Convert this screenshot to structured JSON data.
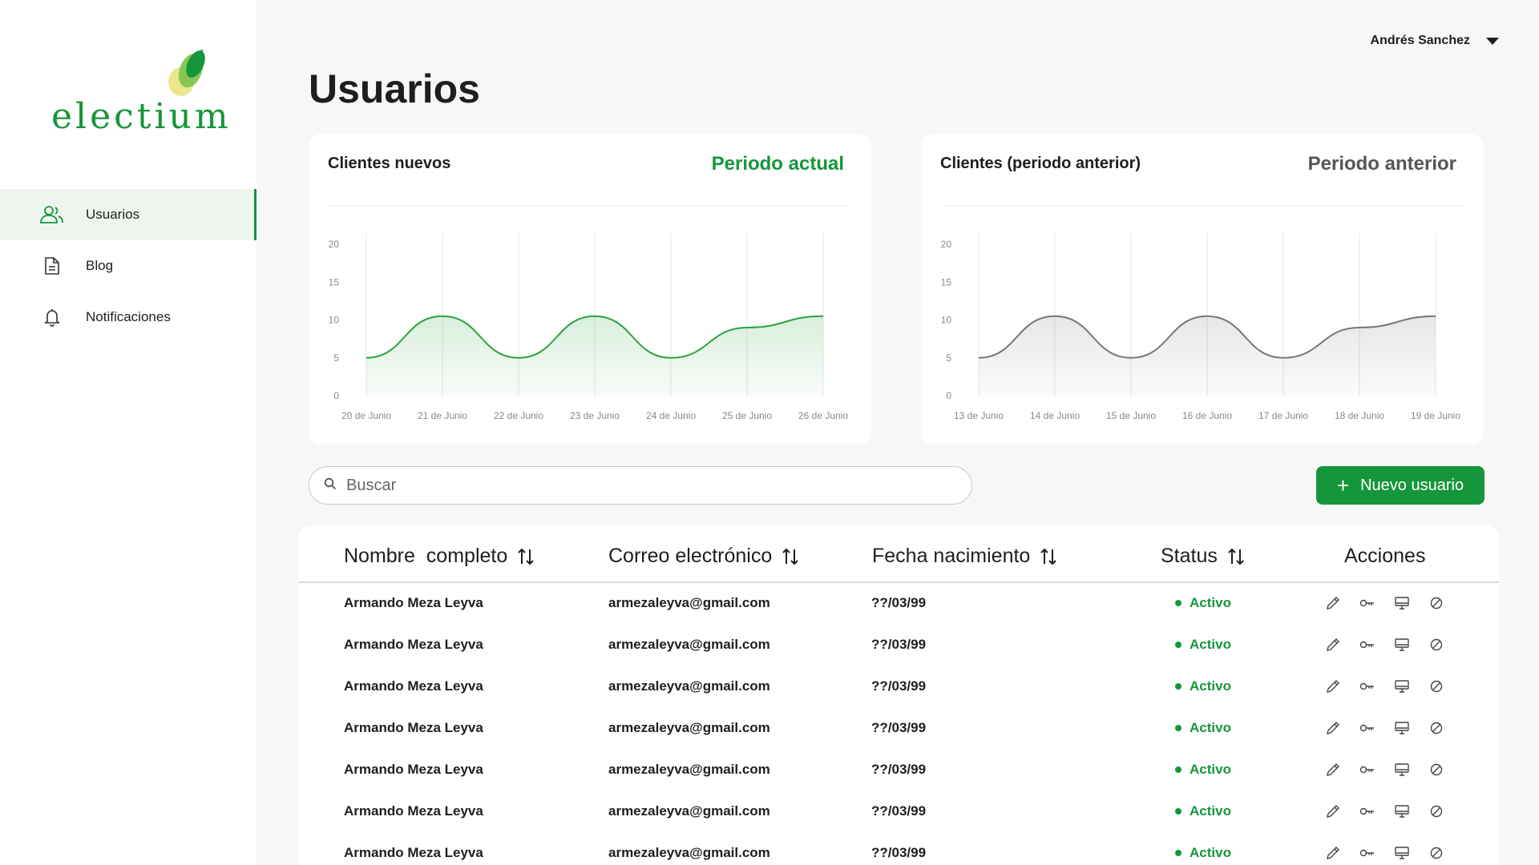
{
  "brand": {
    "name": "electium",
    "color": "#15963a"
  },
  "sidebar": {
    "items": [
      {
        "label": "Usuarios",
        "icon": "users-icon",
        "active": true
      },
      {
        "label": "Blog",
        "icon": "document-icon",
        "active": false
      },
      {
        "label": "Notificaciones",
        "icon": "bell-icon",
        "active": false
      }
    ]
  },
  "header": {
    "user_name": "Andrés Sanchez",
    "title": "Usuarios"
  },
  "cards": [
    {
      "title": "Clientes nuevos",
      "period": "Periodo actual",
      "period_color": "#15963a"
    },
    {
      "title": "Clientes (periodo anterior)",
      "period": "Periodo anterior",
      "period_color": "#555555"
    }
  ],
  "chart_data": [
    {
      "type": "area",
      "title": "Clientes nuevos",
      "categories": [
        "20 de Junio",
        "21 de Junio",
        "22 de Junio",
        "23 de Junio",
        "24 de Junio",
        "25 de Junio",
        "26 de Junio"
      ],
      "values": [
        5,
        10.5,
        5,
        10.5,
        5,
        9,
        10.5
      ],
      "ylim": [
        0,
        20
      ],
      "yticks": [
        0,
        5,
        10,
        15,
        20
      ],
      "color": "#2aa33e",
      "grid": "vertical"
    },
    {
      "type": "area",
      "title": "Clientes (periodo anterior)",
      "categories": [
        "13 de Junio",
        "14 de Junio",
        "15 de Junio",
        "16 de Junio",
        "17 de Junio",
        "18 de Junio",
        "19 de Junio"
      ],
      "values": [
        5,
        10.5,
        5,
        10.5,
        5,
        9,
        10.5
      ],
      "ylim": [
        0,
        20
      ],
      "yticks": [
        0,
        5,
        10,
        15,
        20
      ],
      "color": "#777777",
      "grid": "vertical"
    }
  ],
  "search": {
    "placeholder": "Buscar"
  },
  "new_user_button": {
    "label": "Nuevo usuario"
  },
  "table": {
    "columns": [
      "Nombre  completo",
      "Correo electrónico",
      "Fecha nacimiento",
      "Status",
      "Acciones"
    ],
    "rows": [
      {
        "name": "Armando Meza Leyva",
        "email": "armezaleyva@gmail.com",
        "birth": "??/03/99",
        "status": "Activo"
      },
      {
        "name": "Armando Meza Leyva",
        "email": "armezaleyva@gmail.com",
        "birth": "??/03/99",
        "status": "Activo"
      },
      {
        "name": "Armando Meza Leyva",
        "email": "armezaleyva@gmail.com",
        "birth": "??/03/99",
        "status": "Activo"
      },
      {
        "name": "Armando Meza Leyva",
        "email": "armezaleyva@gmail.com",
        "birth": "??/03/99",
        "status": "Activo"
      },
      {
        "name": "Armando Meza Leyva",
        "email": "armezaleyva@gmail.com",
        "birth": "??/03/99",
        "status": "Activo"
      },
      {
        "name": "Armando Meza Leyva",
        "email": "armezaleyva@gmail.com",
        "birth": "??/03/99",
        "status": "Activo"
      },
      {
        "name": "Armando Meza Leyva",
        "email": "armezaleyva@gmail.com",
        "birth": "??/03/99",
        "status": "Activo"
      }
    ],
    "row_actions": [
      "edit-icon",
      "key-icon",
      "monitor-icon",
      "block-icon"
    ]
  }
}
